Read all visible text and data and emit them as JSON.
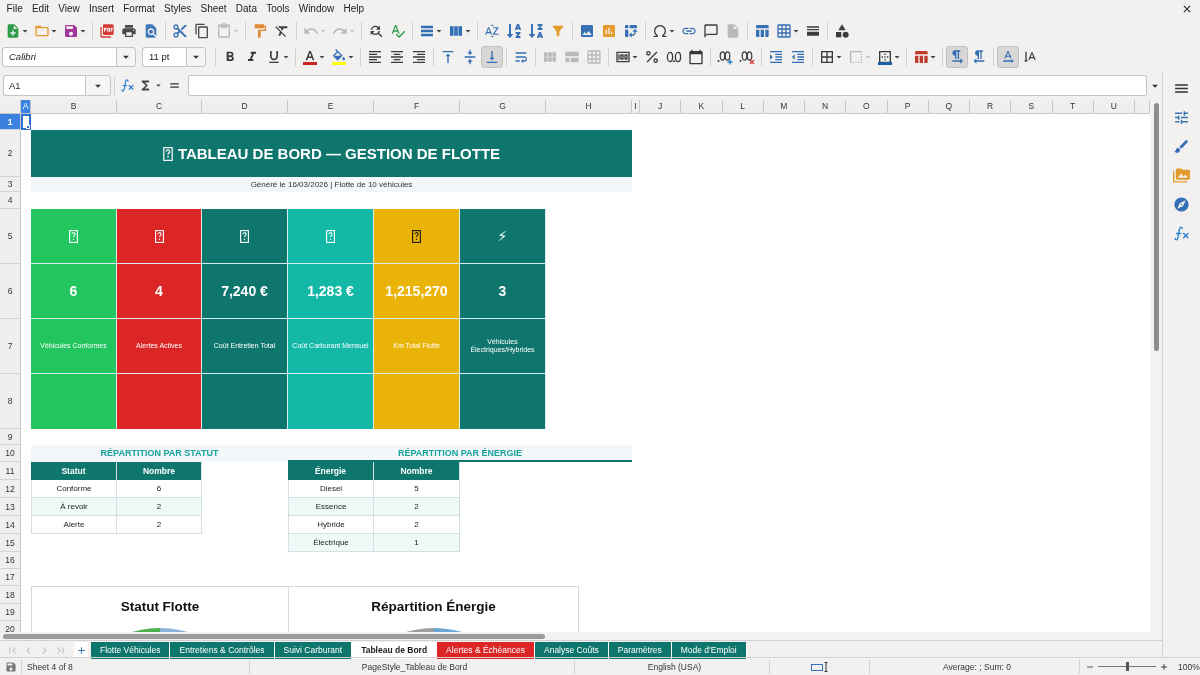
{
  "menu": [
    "File",
    "Edit",
    "View",
    "Insert",
    "Format",
    "Styles",
    "Sheet",
    "Data",
    "Tools",
    "Window",
    "Help"
  ],
  "toolbar_standard": [
    [
      {
        "kind": "new",
        "disabled": false
      },
      {
        "kind": "open",
        "disabled": false
      },
      {
        "kind": "save",
        "disabled": false
      }
    ],
    [
      {
        "kind": "pdf",
        "disabled": false
      },
      {
        "kind": "print",
        "disabled": false
      },
      {
        "kind": "preview",
        "disabled": false
      }
    ],
    [
      {
        "kind": "cut",
        "disabled": false
      },
      {
        "kind": "copy",
        "disabled": false
      },
      {
        "kind": "paste",
        "disabled": true
      }
    ],
    [
      {
        "kind": "clone",
        "disabled": false
      },
      {
        "kind": "clear",
        "disabled": false
      }
    ],
    [
      {
        "kind": "undo",
        "disabled": true
      },
      {
        "kind": "redo",
        "disabled": true
      }
    ],
    [
      {
        "kind": "find",
        "disabled": false
      },
      {
        "kind": "spelling",
        "disabled": false
      }
    ],
    [
      {
        "kind": "rows",
        "disabled": false
      },
      {
        "kind": "columns",
        "disabled": false
      }
    ],
    [
      {
        "kind": "sort",
        "disabled": false
      },
      {
        "kind": "ascending",
        "disabled": false
      },
      {
        "kind": "descending",
        "disabled": false
      },
      {
        "kind": "filter",
        "disabled": false
      }
    ],
    [
      {
        "kind": "image",
        "disabled": false
      },
      {
        "kind": "chart",
        "disabled": false
      },
      {
        "kind": "pivot",
        "disabled": false
      }
    ],
    [
      {
        "kind": "symbol",
        "disabled": false
      },
      {
        "kind": "link",
        "disabled": false
      },
      {
        "kind": "comment",
        "disabled": false
      },
      {
        "kind": "header",
        "disabled": true
      }
    ],
    [
      {
        "kind": "printarea",
        "disabled": false
      },
      {
        "kind": "freeze",
        "disabled": false
      },
      {
        "kind": "split",
        "disabled": false
      }
    ],
    [
      {
        "kind": "shapes",
        "disabled": false
      }
    ]
  ],
  "font_name": "Calibri",
  "font_size": "11 pt",
  "toolbar_formatting": [
    [
      {
        "kind": "bold",
        "on": false,
        "disabled": false
      },
      {
        "kind": "italic",
        "on": false,
        "disabled": false
      },
      {
        "kind": "underline",
        "on": false,
        "disabled": false
      }
    ],
    [
      {
        "kind": "fontcolor",
        "on": false,
        "disabled": false
      },
      {
        "kind": "highlight",
        "on": false,
        "disabled": false
      }
    ],
    [
      {
        "kind": "alignleft",
        "on": false,
        "disabled": false
      },
      {
        "kind": "aligncenter",
        "on": false,
        "disabled": false
      },
      {
        "kind": "alignright",
        "on": false,
        "disabled": false
      }
    ],
    [
      {
        "kind": "aligntop",
        "on": false,
        "disabled": false
      },
      {
        "kind": "alignmiddle",
        "on": false,
        "disabled": false
      },
      {
        "kind": "alignbottom",
        "on": true,
        "disabled": false
      }
    ],
    [
      {
        "kind": "wrap",
        "on": false,
        "disabled": false
      }
    ],
    [
      {
        "kind": "merge",
        "on": false,
        "disabled": true
      },
      {
        "kind": "mergecenter",
        "on": false,
        "disabled": true
      },
      {
        "kind": "unmerge",
        "on": false,
        "disabled": true
      }
    ],
    [
      {
        "kind": "numberformat",
        "on": false,
        "disabled": false
      },
      {
        "kind": "percent",
        "on": false,
        "disabled": false
      },
      {
        "kind": "decimal",
        "on": false,
        "disabled": false
      },
      {
        "kind": "date",
        "on": false,
        "disabled": false
      }
    ],
    [
      {
        "kind": "adddecimal",
        "on": false,
        "disabled": false
      },
      {
        "kind": "deletedecimal",
        "on": false,
        "disabled": false
      }
    ],
    [
      {
        "kind": "indent",
        "on": false,
        "disabled": false
      },
      {
        "kind": "outdent",
        "on": false,
        "disabled": false
      }
    ],
    [
      {
        "kind": "borders",
        "on": false,
        "disabled": false
      },
      {
        "kind": "borderstyle",
        "on": false,
        "disabled": true
      },
      {
        "kind": "bordercolor",
        "on": false,
        "disabled": false
      }
    ],
    [
      {
        "kind": "conditional",
        "on": false,
        "disabled": false
      }
    ],
    [
      {
        "kind": "ltr",
        "on": true,
        "disabled": false
      },
      {
        "kind": "rtl",
        "on": false,
        "disabled": false
      }
    ],
    [
      {
        "kind": "horizontal",
        "on": true,
        "disabled": false
      },
      {
        "kind": "stacked",
        "on": false,
        "disabled": false
      }
    ]
  ],
  "name_box": "A1",
  "columns": [
    {
      "label": "A",
      "selected": true
    },
    {
      "label": "B",
      "selected": false
    },
    {
      "label": "C",
      "selected": false
    },
    {
      "label": "D",
      "selected": false
    },
    {
      "label": "E",
      "selected": false
    },
    {
      "label": "F",
      "selected": false
    },
    {
      "label": "G",
      "selected": false
    },
    {
      "label": "H",
      "selected": false
    },
    {
      "label": "I",
      "selected": false
    },
    {
      "label": "J",
      "selected": false
    },
    {
      "label": "K",
      "selected": false
    },
    {
      "label": "L",
      "selected": false
    },
    {
      "label": "M",
      "selected": false
    },
    {
      "label": "N",
      "selected": false
    },
    {
      "label": "O",
      "selected": false
    },
    {
      "label": "P",
      "selected": false
    },
    {
      "label": "Q",
      "selected": false
    },
    {
      "label": "R",
      "selected": false
    },
    {
      "label": "S",
      "selected": false
    },
    {
      "label": "T",
      "selected": false
    },
    {
      "label": "U",
      "selected": false
    }
  ],
  "rows": [
    {
      "label": "1",
      "selected": true
    },
    {
      "label": "2",
      "selected": false
    },
    {
      "label": "3",
      "selected": false
    },
    {
      "label": "4",
      "selected": false
    },
    {
      "label": "5",
      "selected": false
    },
    {
      "label": "6",
      "selected": false
    },
    {
      "label": "7",
      "selected": false
    },
    {
      "label": "8",
      "selected": false
    },
    {
      "label": "9",
      "selected": false
    },
    {
      "label": "10",
      "selected": false
    },
    {
      "label": "11",
      "selected": false
    },
    {
      "label": "12",
      "selected": false
    },
    {
      "label": "13",
      "selected": false
    },
    {
      "label": "14",
      "selected": false
    },
    {
      "label": "15",
      "selected": false
    },
    {
      "label": "16",
      "selected": false
    },
    {
      "label": "17",
      "selected": false
    },
    {
      "label": "18",
      "selected": false
    },
    {
      "label": "19",
      "selected": false
    },
    {
      "label": "20",
      "selected": false
    }
  ],
  "title": "TABLEAU DE BORD — GESTION DE FLOTTE",
  "subtitle": "Généré le 16/03/2026 | Flotte de 10 véhicules",
  "kpis": [
    {
      "value": "6",
      "label": "Véhicules Conformes",
      "color": "#22c55e"
    },
    {
      "value": "4",
      "label": "Alertes Actives",
      "color": "#dc2626"
    },
    {
      "value": "7,240 €",
      "label": "Coût Entretien Total",
      "color": "#0f766e"
    },
    {
      "value": "1,283 €",
      "label": "Coût Carburant Mensuel",
      "color": "#14b8a6"
    },
    {
      "value": "1,215,270",
      "label": "Km Total Flotte",
      "color": "#eab308"
    },
    {
      "symbol": "⚡",
      "value": "3",
      "label": "Véhicules Électriques/Hybrides",
      "color": "#0f766e"
    }
  ],
  "tables": [
    {
      "title": "RÉPARTITION PAR STATUT",
      "rule_below": false,
      "columns": [
        "Statut",
        "Nombre"
      ],
      "rows": [
        [
          "Conforme",
          "6"
        ],
        [
          "À revoir",
          "2"
        ],
        [
          "Alerte",
          "2"
        ]
      ]
    },
    {
      "title": "RÉPARTITION PAR ÉNERGIE",
      "rule_below": true,
      "columns": [
        "Énergie",
        "Nombre"
      ],
      "rows": [
        [
          "Diesel",
          "5"
        ],
        [
          "Essence",
          "2"
        ],
        [
          "Hybride",
          "2"
        ],
        [
          "Électrique",
          "1"
        ]
      ]
    }
  ],
  "charts": [
    {
      "title": "Statut Flotte"
    },
    {
      "title": "Répartition Énergie"
    }
  ],
  "tab_navigation": [
    {
      "kind": "first",
      "disabled": true
    },
    {
      "kind": "previous",
      "disabled": true
    },
    {
      "kind": "next",
      "disabled": true
    },
    {
      "kind": "last",
      "disabled": true
    }
  ],
  "sheet_tabs": [
    {
      "label": "Flotte Véhicules",
      "selected": false,
      "color": "#0f766e"
    },
    {
      "label": "Entretiens & Contrôles",
      "selected": false,
      "color": "#0f766e"
    },
    {
      "label": "Suivi Carburant",
      "selected": false,
      "color": "#0f766e"
    },
    {
      "label": "Tableau de Bord",
      "selected": true
    },
    {
      "label": "Alertes & Échéances",
      "selected": false,
      "color": "#dc2626"
    },
    {
      "label": "Analyse Coûts",
      "selected": false,
      "color": "#0f766e"
    },
    {
      "label": "Paramètres",
      "selected": false,
      "color": "#0f766e"
    },
    {
      "label": "Mode d'Emploi",
      "selected": false,
      "color": "#0f766e"
    }
  ],
  "status_bar": {
    "sheet": "Sheet 4 of 8",
    "page_style": "PageStyle_Tableau de Bord",
    "language": "English (USA)",
    "summary": "Average: ; Sum: 0",
    "zoom": "100%",
    "zoom_slider": {
      "level": 0.5
    }
  }
}
